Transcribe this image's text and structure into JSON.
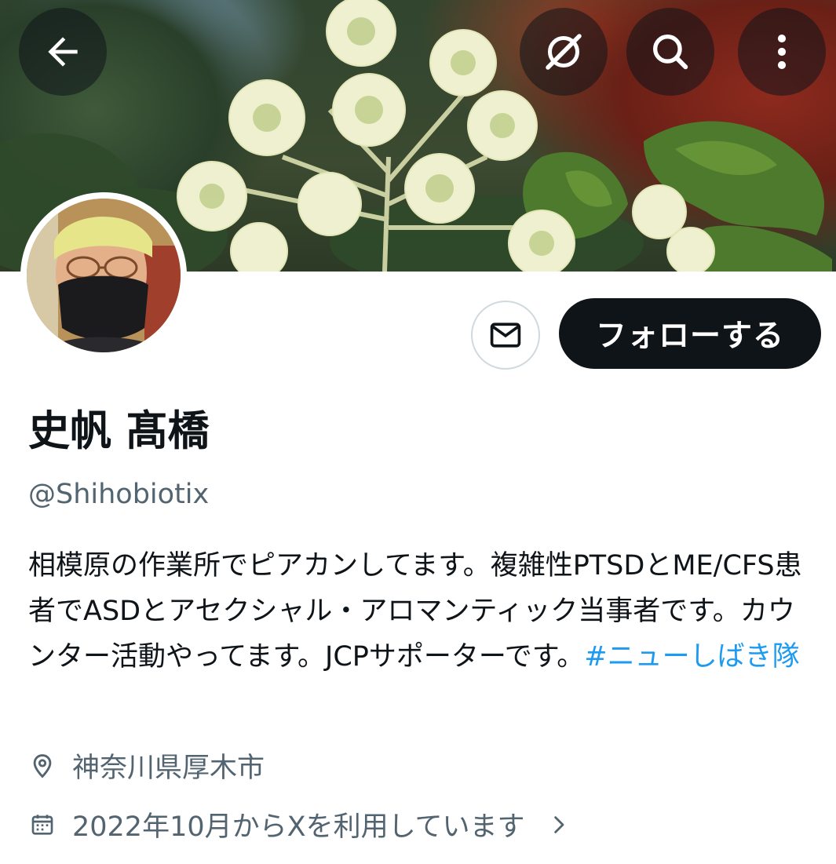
{
  "header": {
    "back_icon": "arrow-left-icon",
    "grok_icon": "grok-icon",
    "search_icon": "search-icon",
    "more_icon": "more-vertical-icon"
  },
  "profile": {
    "display_name": "史帆 髙橋",
    "handle": "@Shihobiotix",
    "bio_text": "相模原の作業所でピアカンしてます。複雑性PTSDとME/CFS患者でASDとアセクシャル・アロマンティック当事者です。カウンター活動やってます。JCPサポーターです。",
    "bio_hashtag": "#ニューしばき隊",
    "location": "神奈川県厚木市",
    "joined": "2022年10月からXを利用しています"
  },
  "actions": {
    "message_icon": "envelope-icon",
    "follow_label": "フォローする"
  },
  "colors": {
    "text_primary": "#0f1419",
    "text_secondary": "#536471",
    "link": "#1d9bf0",
    "button_dark": "#0f1419",
    "border": "#cfd9de"
  }
}
